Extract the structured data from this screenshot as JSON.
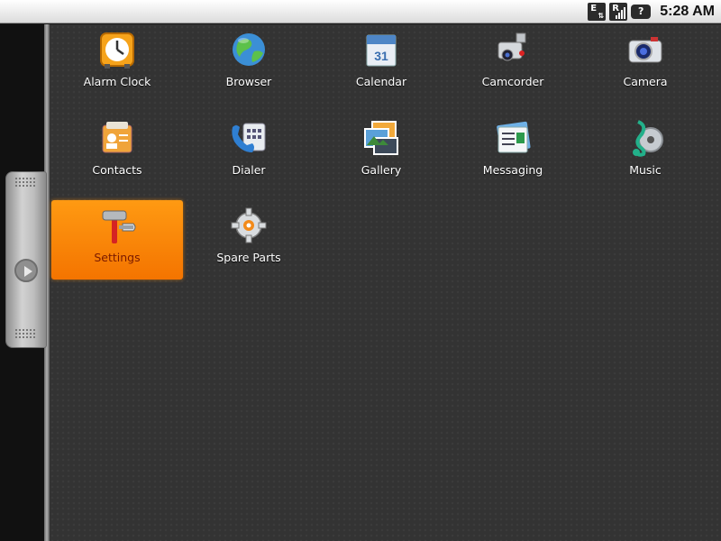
{
  "status_bar": {
    "network_letter": "E",
    "roaming_letter": "R",
    "battery_symbol": "?",
    "time": "5:28 AM"
  },
  "apps": [
    {
      "label": "Alarm Clock",
      "icon": "alarm-clock-icon"
    },
    {
      "label": "Browser",
      "icon": "globe-icon"
    },
    {
      "label": "Calendar",
      "icon": "calendar-icon",
      "icon_text": "31"
    },
    {
      "label": "Camcorder",
      "icon": "camcorder-icon"
    },
    {
      "label": "Camera",
      "icon": "camera-icon"
    },
    {
      "label": "Contacts",
      "icon": "contacts-icon"
    },
    {
      "label": "Dialer",
      "icon": "phone-icon"
    },
    {
      "label": "Gallery",
      "icon": "gallery-icon"
    },
    {
      "label": "Messaging",
      "icon": "messaging-icon"
    },
    {
      "label": "Music",
      "icon": "music-icon"
    },
    {
      "label": "Settings",
      "icon": "settings-icon",
      "selected": true
    },
    {
      "label": "Spare Parts",
      "icon": "spare-parts-icon"
    }
  ],
  "colors": {
    "selection": "#f47400",
    "background": "#333333"
  }
}
